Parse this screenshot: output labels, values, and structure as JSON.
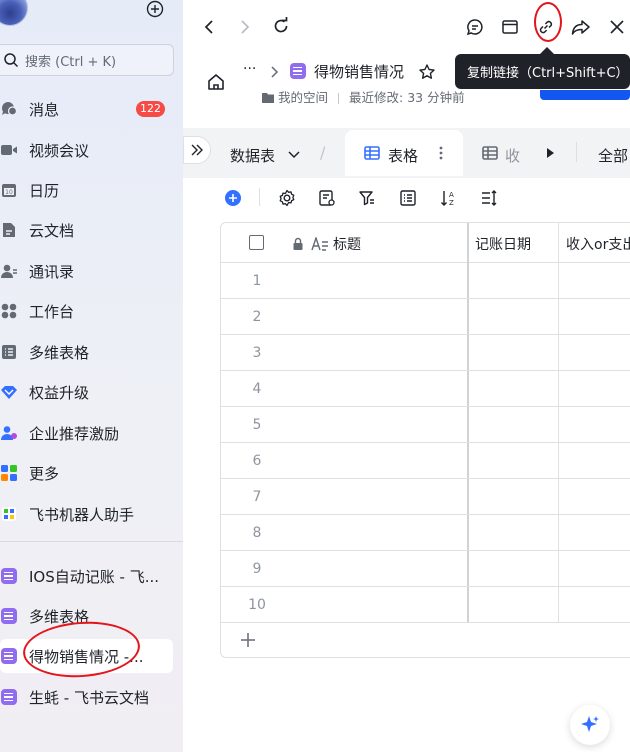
{
  "sidebar": {
    "search_placeholder": "搜索 (Ctrl + K)",
    "items": [
      {
        "label": "消息",
        "icon": "chat-bubble-icon",
        "badge": "122"
      },
      {
        "label": "视频会议",
        "icon": "video-camera-icon"
      },
      {
        "label": "日历",
        "icon": "calendar-icon"
      },
      {
        "label": "云文档",
        "icon": "cloud-doc-icon"
      },
      {
        "label": "通讯录",
        "icon": "contacts-icon"
      },
      {
        "label": "工作台",
        "icon": "workspace-grid-icon"
      },
      {
        "label": "多维表格",
        "icon": "base-table-icon"
      },
      {
        "label": "权益升级",
        "icon": "diamond-icon"
      },
      {
        "label": "企业推荐激励",
        "icon": "referral-icon"
      },
      {
        "label": "更多",
        "icon": "more-apps-icon"
      },
      {
        "label": "飞书机器人助手",
        "icon": "bot-icon"
      }
    ],
    "docs": [
      {
        "label": "IOS自动记账 - 飞..."
      },
      {
        "label": "多维表格"
      },
      {
        "label": "得物销售情况 -..."
      },
      {
        "label": "生蚝 - 飞书云文档"
      }
    ]
  },
  "tooltip": {
    "copy_link": "复制链接（Ctrl+Shift+C）"
  },
  "header": {
    "ellipsis": "···",
    "title": "得物销售情况",
    "space": "我的空间",
    "last_modified": "最近修改: 33 分钟前"
  },
  "tabs": {
    "datatable": "数据表",
    "grid_view": "表格",
    "collapsed_view": "收",
    "all": "全部"
  },
  "grid": {
    "columns": [
      "标题",
      "记账日期",
      "收入or支出"
    ],
    "rows": [
      "1",
      "2",
      "3",
      "4",
      "5",
      "6",
      "7",
      "8",
      "9",
      "10"
    ]
  },
  "colors": {
    "accent": "#1456f0",
    "badge": "#f54a45",
    "doc_icon": "#8f6cf0",
    "annotation": "#e3141a"
  }
}
